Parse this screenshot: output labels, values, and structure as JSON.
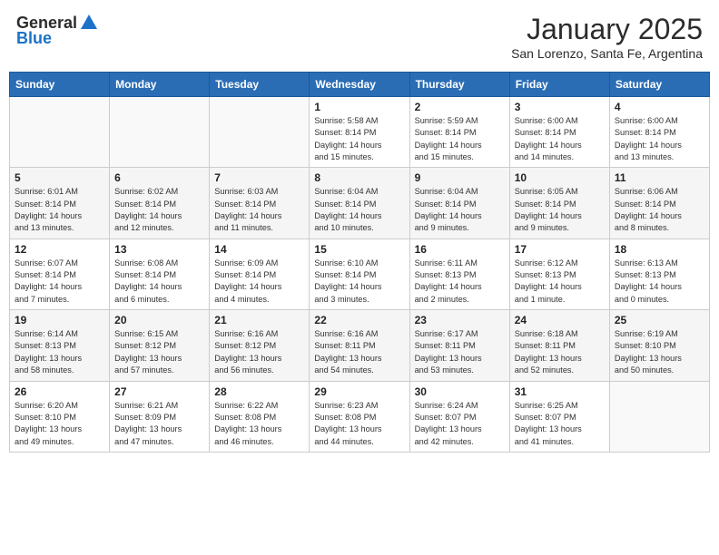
{
  "header": {
    "logo_general": "General",
    "logo_blue": "Blue",
    "month_title": "January 2025",
    "subtitle": "San Lorenzo, Santa Fe, Argentina"
  },
  "days_of_week": [
    "Sunday",
    "Monday",
    "Tuesday",
    "Wednesday",
    "Thursday",
    "Friday",
    "Saturday"
  ],
  "weeks": [
    [
      {
        "day": "",
        "info": ""
      },
      {
        "day": "",
        "info": ""
      },
      {
        "day": "",
        "info": ""
      },
      {
        "day": "1",
        "info": "Sunrise: 5:58 AM\nSunset: 8:14 PM\nDaylight: 14 hours\nand 15 minutes."
      },
      {
        "day": "2",
        "info": "Sunrise: 5:59 AM\nSunset: 8:14 PM\nDaylight: 14 hours\nand 15 minutes."
      },
      {
        "day": "3",
        "info": "Sunrise: 6:00 AM\nSunset: 8:14 PM\nDaylight: 14 hours\nand 14 minutes."
      },
      {
        "day": "4",
        "info": "Sunrise: 6:00 AM\nSunset: 8:14 PM\nDaylight: 14 hours\nand 13 minutes."
      }
    ],
    [
      {
        "day": "5",
        "info": "Sunrise: 6:01 AM\nSunset: 8:14 PM\nDaylight: 14 hours\nand 13 minutes."
      },
      {
        "day": "6",
        "info": "Sunrise: 6:02 AM\nSunset: 8:14 PM\nDaylight: 14 hours\nand 12 minutes."
      },
      {
        "day": "7",
        "info": "Sunrise: 6:03 AM\nSunset: 8:14 PM\nDaylight: 14 hours\nand 11 minutes."
      },
      {
        "day": "8",
        "info": "Sunrise: 6:04 AM\nSunset: 8:14 PM\nDaylight: 14 hours\nand 10 minutes."
      },
      {
        "day": "9",
        "info": "Sunrise: 6:04 AM\nSunset: 8:14 PM\nDaylight: 14 hours\nand 9 minutes."
      },
      {
        "day": "10",
        "info": "Sunrise: 6:05 AM\nSunset: 8:14 PM\nDaylight: 14 hours\nand 9 minutes."
      },
      {
        "day": "11",
        "info": "Sunrise: 6:06 AM\nSunset: 8:14 PM\nDaylight: 14 hours\nand 8 minutes."
      }
    ],
    [
      {
        "day": "12",
        "info": "Sunrise: 6:07 AM\nSunset: 8:14 PM\nDaylight: 14 hours\nand 7 minutes."
      },
      {
        "day": "13",
        "info": "Sunrise: 6:08 AM\nSunset: 8:14 PM\nDaylight: 14 hours\nand 6 minutes."
      },
      {
        "day": "14",
        "info": "Sunrise: 6:09 AM\nSunset: 8:14 PM\nDaylight: 14 hours\nand 4 minutes."
      },
      {
        "day": "15",
        "info": "Sunrise: 6:10 AM\nSunset: 8:14 PM\nDaylight: 14 hours\nand 3 minutes."
      },
      {
        "day": "16",
        "info": "Sunrise: 6:11 AM\nSunset: 8:13 PM\nDaylight: 14 hours\nand 2 minutes."
      },
      {
        "day": "17",
        "info": "Sunrise: 6:12 AM\nSunset: 8:13 PM\nDaylight: 14 hours\nand 1 minute."
      },
      {
        "day": "18",
        "info": "Sunrise: 6:13 AM\nSunset: 8:13 PM\nDaylight: 14 hours\nand 0 minutes."
      }
    ],
    [
      {
        "day": "19",
        "info": "Sunrise: 6:14 AM\nSunset: 8:13 PM\nDaylight: 13 hours\nand 58 minutes."
      },
      {
        "day": "20",
        "info": "Sunrise: 6:15 AM\nSunset: 8:12 PM\nDaylight: 13 hours\nand 57 minutes."
      },
      {
        "day": "21",
        "info": "Sunrise: 6:16 AM\nSunset: 8:12 PM\nDaylight: 13 hours\nand 56 minutes."
      },
      {
        "day": "22",
        "info": "Sunrise: 6:16 AM\nSunset: 8:11 PM\nDaylight: 13 hours\nand 54 minutes."
      },
      {
        "day": "23",
        "info": "Sunrise: 6:17 AM\nSunset: 8:11 PM\nDaylight: 13 hours\nand 53 minutes."
      },
      {
        "day": "24",
        "info": "Sunrise: 6:18 AM\nSunset: 8:11 PM\nDaylight: 13 hours\nand 52 minutes."
      },
      {
        "day": "25",
        "info": "Sunrise: 6:19 AM\nSunset: 8:10 PM\nDaylight: 13 hours\nand 50 minutes."
      }
    ],
    [
      {
        "day": "26",
        "info": "Sunrise: 6:20 AM\nSunset: 8:10 PM\nDaylight: 13 hours\nand 49 minutes."
      },
      {
        "day": "27",
        "info": "Sunrise: 6:21 AM\nSunset: 8:09 PM\nDaylight: 13 hours\nand 47 minutes."
      },
      {
        "day": "28",
        "info": "Sunrise: 6:22 AM\nSunset: 8:08 PM\nDaylight: 13 hours\nand 46 minutes."
      },
      {
        "day": "29",
        "info": "Sunrise: 6:23 AM\nSunset: 8:08 PM\nDaylight: 13 hours\nand 44 minutes."
      },
      {
        "day": "30",
        "info": "Sunrise: 6:24 AM\nSunset: 8:07 PM\nDaylight: 13 hours\nand 42 minutes."
      },
      {
        "day": "31",
        "info": "Sunrise: 6:25 AM\nSunset: 8:07 PM\nDaylight: 13 hours\nand 41 minutes."
      },
      {
        "day": "",
        "info": ""
      }
    ]
  ]
}
